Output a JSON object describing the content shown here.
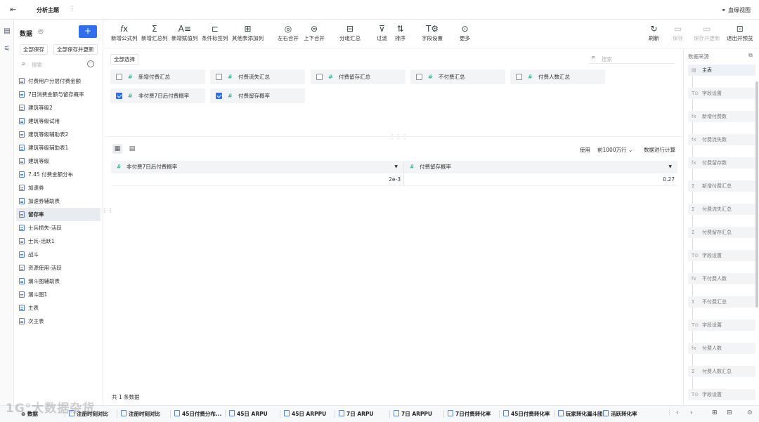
{
  "header": {
    "title": "分析主题",
    "lineage_label": "血缘视图"
  },
  "sidebar": {
    "title": "数据",
    "save_all": "全部保存",
    "save_all_update": "全部保存并更新",
    "search_placeholder": "搜索",
    "tables": [
      {
        "label": "付费用户分层付费金额"
      },
      {
        "label": "7日消费金额与留存概率"
      },
      {
        "label": "建筑等级2"
      },
      {
        "label": "建筑等级试用"
      },
      {
        "label": "建筑等级辅助表2"
      },
      {
        "label": "建筑等级辅助表1"
      },
      {
        "label": "建筑等级"
      },
      {
        "label": "7.45 付费金额分布"
      },
      {
        "label": "加速券"
      },
      {
        "label": "加速券辅助表"
      },
      {
        "label": "留存率",
        "active": true
      },
      {
        "label": "士兵损失-活跃"
      },
      {
        "label": "士兵-活跃1"
      },
      {
        "label": "战斗"
      },
      {
        "label": "资源使用-活跃"
      },
      {
        "label": "漏斗图辅助表"
      },
      {
        "label": "漏斗图1"
      },
      {
        "label": "主表"
      },
      {
        "label": "次主表"
      }
    ]
  },
  "toolbar": {
    "add_formula": "新增公式列",
    "add_summary": "新增汇总列",
    "add_assign": "新增赋值列",
    "add_condition": "条件标签列",
    "add_other_table": "其他表添加列",
    "merge_lr": "左右合并",
    "merge_tb": "上下合并",
    "group_summary": "分组汇总",
    "filter": "过滤",
    "sort": "排序",
    "field_settings": "字段设置",
    "more": "更多",
    "refresh": "刷新",
    "save": "保存",
    "save_update": "保存并更新",
    "exit_preview": "退出并预览"
  },
  "fields": {
    "select_all": "全部选择",
    "search_placeholder": "搜索",
    "items": [
      {
        "label": "新增付费汇总",
        "checked": false
      },
      {
        "label": "付费流失汇总",
        "checked": false
      },
      {
        "label": "付费留存汇总",
        "checked": false
      },
      {
        "label": "不付费汇总",
        "checked": false
      },
      {
        "label": "付费人数汇总",
        "checked": false
      },
      {
        "label": "非付费7日后付费概率",
        "checked": true
      },
      {
        "label": "付费留存概率",
        "checked": true
      }
    ]
  },
  "preview": {
    "use_label": "使用",
    "rows_option": "前1000万行",
    "compute_label": "数据进行计算",
    "columns": [
      "非付费7日后付费概率",
      "付费留存概率"
    ],
    "rows": [
      [
        "2e-3",
        "0.27"
      ]
    ],
    "count_text": "共 1 条数据"
  },
  "steps": {
    "title": "数据来源",
    "items": [
      {
        "icon": "table",
        "label": "主表"
      },
      {
        "icon": "T",
        "label": "字段设置"
      },
      {
        "icon": "fx",
        "label": "新增付费数"
      },
      {
        "icon": "fx",
        "label": "付费流失数"
      },
      {
        "icon": "fx",
        "label": "付费留存数"
      },
      {
        "icon": "Σ",
        "label": "新增付费汇总"
      },
      {
        "icon": "Σ",
        "label": "付费流失汇总"
      },
      {
        "icon": "Σ",
        "label": "付费留存汇总"
      },
      {
        "icon": "T",
        "label": "字段设置"
      },
      {
        "icon": "fx",
        "label": "不付费人数"
      },
      {
        "icon": "Σ",
        "label": "不付费汇总"
      },
      {
        "icon": "T",
        "label": "字段设置"
      },
      {
        "icon": "fx",
        "label": "付费人数"
      },
      {
        "icon": "Σ",
        "label": "付费人数汇总"
      },
      {
        "icon": "T",
        "label": "字段设置"
      }
    ]
  },
  "bottom_tabs": {
    "data_tab": "数据",
    "tabs": [
      "注册时刻对比",
      "注册时刻对比",
      "45日付费分布...",
      "45日 ARPU",
      "45日 ARPPU",
      "7日 ARPU",
      "7日 ARPPU",
      "7日付费转化率",
      "45日付费转化率",
      "玩家转化漏斗图",
      "活跃转化率"
    ]
  },
  "watermark": "大数据杂货"
}
